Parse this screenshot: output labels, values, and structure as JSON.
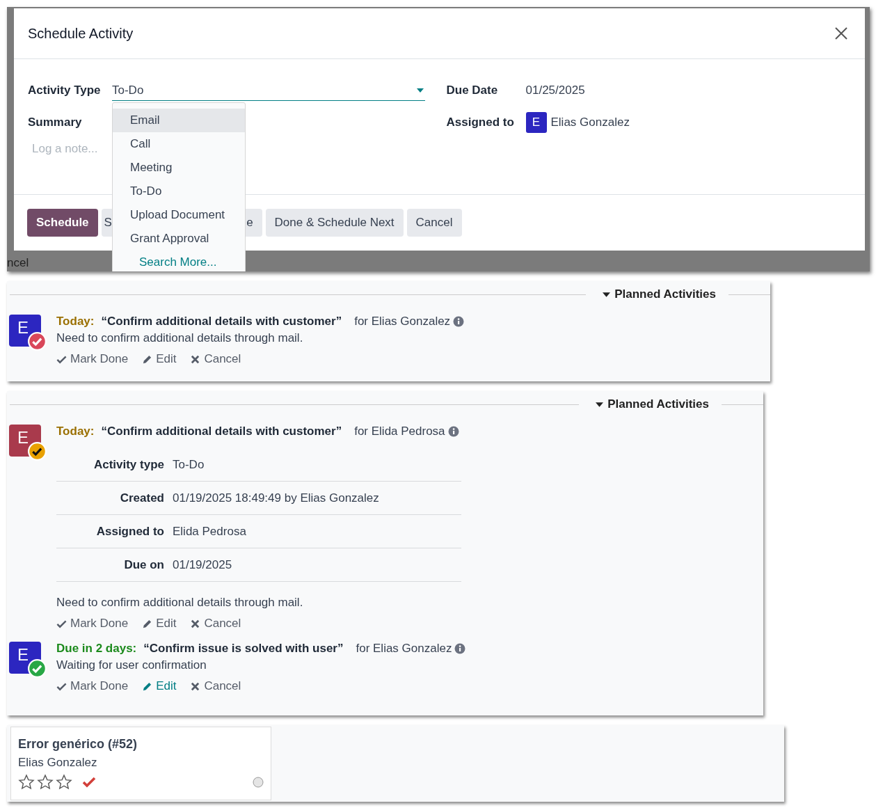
{
  "schedule_dialog": {
    "title": "Schedule Activity",
    "backdrop_fragments": [
      "ncel"
    ],
    "activity_type": {
      "label": "Activity Type",
      "value": "To-Do"
    },
    "summary": {
      "label": "Summary"
    },
    "note": {
      "placeholder": "Log a note..."
    },
    "due_date": {
      "label": "Due Date",
      "value": "01/25/2025"
    },
    "assigned_to": {
      "label": "Assigned to",
      "avatar_letter": "E",
      "value": "Elias Gonzalez"
    },
    "buttons": [
      {
        "label": "Schedule",
        "kind": "primary"
      },
      {
        "label": "S",
        "kind": "partial-left"
      },
      {
        "label": "e",
        "kind": "partial-right"
      },
      {
        "label": "Done & Schedule Next",
        "kind": "secondary"
      },
      {
        "label": "Cancel",
        "kind": "secondary"
      }
    ],
    "dropdown": {
      "items": [
        {
          "label": "Email",
          "selected": true
        },
        {
          "label": "Call",
          "selected": false
        },
        {
          "label": "Meeting",
          "selected": false
        },
        {
          "label": "To-Do",
          "selected": false
        },
        {
          "label": "Upload Document",
          "selected": false
        },
        {
          "label": "Grant Approval",
          "selected": false
        }
      ],
      "search_more": "Search More..."
    }
  },
  "activity_panels": [
    {
      "header": "Planned Activities",
      "activities": [
        {
          "avatar": {
            "letter": "E",
            "color": "#2c26c0"
          },
          "badge": {
            "color": "#d9475a"
          },
          "due": {
            "label": "Today:",
            "color": "#9a6f00"
          },
          "summary": "“Confirm additional details with customer”",
          "assignee": "for Elias Gonzalez",
          "note": "Need to confirm additional details through mail.",
          "actions": [
            {
              "label": "Mark Done",
              "kind": "done",
              "highlighted": false
            },
            {
              "label": "Edit",
              "kind": "edit",
              "highlighted": false
            },
            {
              "label": "Cancel",
              "kind": "cancel",
              "highlighted": false
            }
          ]
        }
      ]
    },
    {
      "header": "Planned Activities",
      "activities": [
        {
          "avatar": {
            "letter": "E",
            "color": "#a93a4c"
          },
          "badge": {
            "color": "#e9a100"
          },
          "due": {
            "label": "Today:",
            "color": "#9a6f00"
          },
          "summary": "“Confirm additional details with customer”",
          "assignee": "for Elida Pedrosa",
          "details": [
            {
              "label": "Activity type",
              "value": "To-Do"
            },
            {
              "label": "Created",
              "value": "01/19/2025 18:49:49 by Elias Gonzalez"
            },
            {
              "label": "Assigned to",
              "value": "Elida Pedrosa"
            },
            {
              "label": "Due on",
              "value": "01/19/2025"
            }
          ],
          "note": "Need to confirm additional details through mail.",
          "actions": [
            {
              "label": "Mark Done",
              "kind": "done",
              "highlighted": false
            },
            {
              "label": "Edit",
              "kind": "edit",
              "highlighted": false
            },
            {
              "label": "Cancel",
              "kind": "cancel",
              "highlighted": false
            }
          ]
        },
        {
          "avatar": {
            "letter": "E",
            "color": "#2c26c0"
          },
          "badge": {
            "color": "#28a745"
          },
          "due": {
            "label": "Due in 2 days:",
            "color": "#1c8a1c"
          },
          "summary": "“Confirm issue is solved with user”",
          "assignee": "for Elias Gonzalez",
          "note": "Waiting for user confirmation",
          "actions": [
            {
              "label": "Mark Done",
              "kind": "done",
              "highlighted": false
            },
            {
              "label": "Edit",
              "kind": "edit",
              "highlighted": true
            },
            {
              "label": "Cancel",
              "kind": "cancel",
              "highlighted": false
            }
          ]
        }
      ]
    }
  ],
  "kanban_card": {
    "title": "Error genérico (#52)",
    "assignee": "Elias Gonzalez",
    "stars": 0
  }
}
